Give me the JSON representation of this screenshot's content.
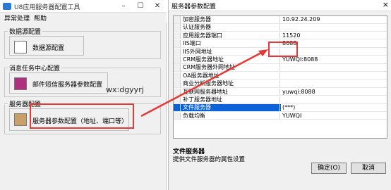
{
  "main_window": {
    "title": "U8应用服务器配置工具",
    "menu": [
      "异常处理",
      "帮助"
    ],
    "groups": [
      {
        "title": "数据源配置",
        "button": "数据源配置"
      },
      {
        "title": "消息任务中心配置",
        "button": "邮件短信服务器参数配置"
      },
      {
        "title": "服务器配置",
        "button": "服务器参数配置（地址、端口等）"
      }
    ]
  },
  "watermark": "wx:dgyyrj",
  "dialog": {
    "title": "服务器参数配置",
    "close": "×",
    "rows": [
      {
        "name": "加密服务器",
        "value": "10.92.24.209"
      },
      {
        "name": "认证服务器",
        "value": ""
      },
      {
        "name": "应用服务器端口",
        "value": "11520"
      },
      {
        "name": "IIS端口",
        "value": "8088"
      },
      {
        "name": "IIS外网地址",
        "value": ""
      },
      {
        "name": "CRM服务器地址",
        "value": "YUWQI:8088"
      },
      {
        "name": "CRM服务器外网地址",
        "value": ""
      },
      {
        "name": "OA服务器地址",
        "value": ""
      },
      {
        "name": "商业分析服务器地址",
        "value": ""
      },
      {
        "name": "互联网服务器地址",
        "value": "yuwqi:8088"
      },
      {
        "name": "补丁服务器地址",
        "value": ""
      },
      {
        "name": "文件服务器",
        "value": "(***)"
      },
      {
        "name": "负载均衡",
        "value": "YUWQI"
      }
    ],
    "desc_title": "文件服务器",
    "desc_text": "提供文件服务器的属性设置",
    "ok": "确定(O)",
    "cancel": "取消"
  },
  "colors": {
    "highlight_red": "#e53935",
    "selection_blue": "#0a64d7"
  }
}
